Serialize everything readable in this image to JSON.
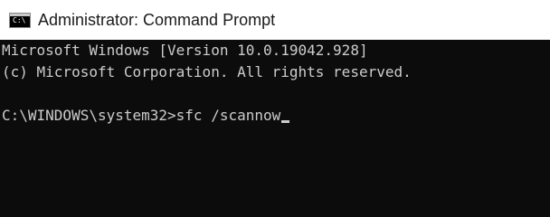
{
  "window": {
    "title": "Administrator: Command Prompt",
    "icon": "cmd-icon",
    "icon_text": "C:\\"
  },
  "console": {
    "lines": [
      "Microsoft Windows [Version 10.0.19042.928]",
      "(c) Microsoft Corporation. All rights reserved.",
      ""
    ],
    "prompt": "C:\\WINDOWS\\system32>",
    "input": "sfc /scannow"
  },
  "colors": {
    "console_background": "#0c0c0c",
    "console_text": "#cccccc",
    "titlebar_background": "#ffffff"
  }
}
